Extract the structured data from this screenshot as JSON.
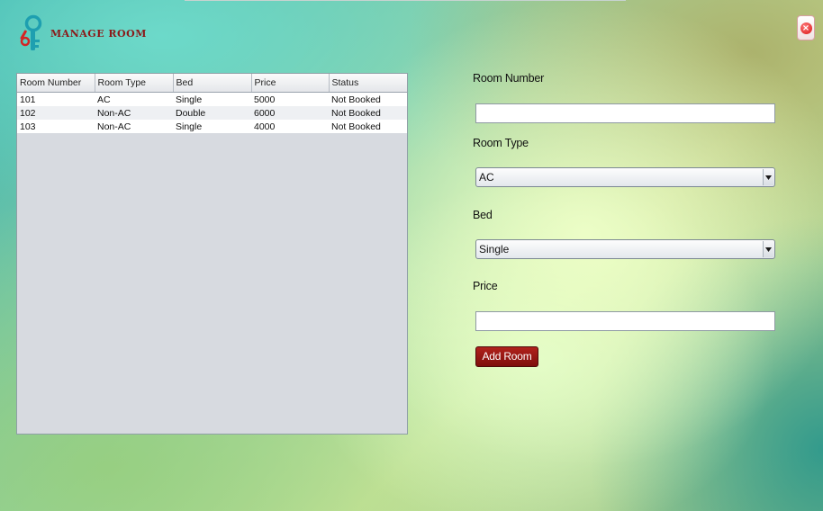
{
  "header": {
    "title": "MANAGE ROOM",
    "close_symbol": "×"
  },
  "table": {
    "columns": [
      "Room Number",
      "Room Type",
      "Bed",
      "Price",
      "Status"
    ],
    "rows": [
      [
        "101",
        "AC",
        "Single",
        "5000",
        "Not Booked"
      ],
      [
        "102",
        "Non-AC",
        "Double",
        "6000",
        "Not Booked"
      ],
      [
        "103",
        "Non-AC",
        "Single",
        "4000",
        "Not Booked"
      ]
    ]
  },
  "form": {
    "room_number_label": "Room Number",
    "room_number_value": "",
    "room_type_label": "Room Type",
    "room_type_value": "AC",
    "bed_label": "Bed",
    "bed_value": "Single",
    "price_label": "Price",
    "price_value": "",
    "add_button_label": "Add Room"
  },
  "colors": {
    "accent": "#8b1a1a",
    "button": "#9a1a16",
    "close": "#d81414"
  },
  "icons": {
    "logo": "keys-icon",
    "close": "close-icon",
    "dropdown": "chevron-down-icon"
  }
}
